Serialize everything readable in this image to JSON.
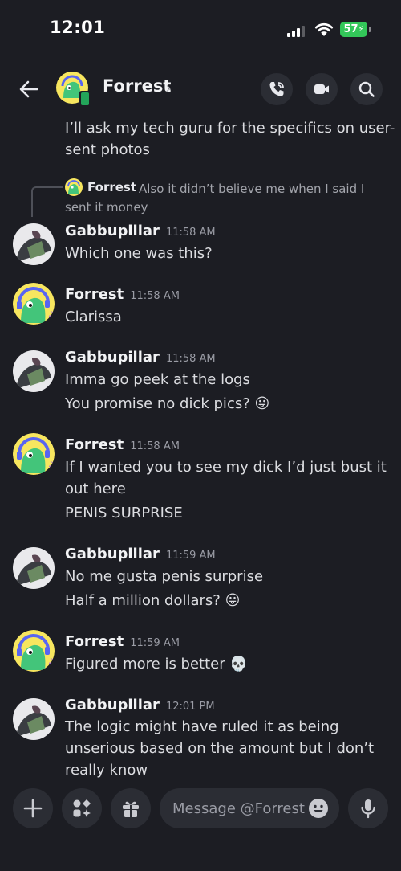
{
  "status_bar": {
    "time": "12:01",
    "battery": "57"
  },
  "header": {
    "title": "Forrest",
    "chevron": "›"
  },
  "messages": {
    "m0": {
      "line1": "I’ll ask my tech guru for the specifics on user-",
      "line2": "sent photos"
    },
    "reply": {
      "name": "Forrest",
      "text": "Also it didn’t believe me when I said I sent it money"
    },
    "m1": {
      "author": "Gabbupillar",
      "time": "11:58 AM",
      "l1": "Which one was this?"
    },
    "m2": {
      "author": "Forrest",
      "time": "11:58 AM",
      "l1": "Clarissa"
    },
    "m3": {
      "author": "Gabbupillar",
      "time": "11:58 AM",
      "l1": "Imma go peek at the logs",
      "l2": "You promise no dick pics? 😛"
    },
    "m4": {
      "author": "Forrest",
      "time": "11:58 AM",
      "l1": "If I wanted you to see my dick I’d just bust it",
      "l2": "out here",
      "l3": "PENIS SURPRISE"
    },
    "m5": {
      "author": "Gabbupillar",
      "time": "11:59 AM",
      "l1": "No me gusta penis surprise",
      "l2": "Half a million dollars? 😛"
    },
    "m6": {
      "author": "Forrest",
      "time": "11:59 AM",
      "l1": "Figured more is better 💀"
    },
    "m7": {
      "author": "Gabbupillar",
      "time": "12:01 PM",
      "l1": "The logic might have ruled it as being",
      "l2": "unserious based on the amount but I don’t",
      "l3": "really know"
    }
  },
  "composer": {
    "placeholder": "Message @Forrest"
  },
  "icons": [
    "back-arrow-icon",
    "phone-call-icon",
    "video-call-icon",
    "search-icon",
    "plus-icon",
    "apps-icon",
    "gift-icon",
    "emoji-icon",
    "microphone-icon"
  ],
  "colors": {
    "background": "#1c1d23",
    "button": "#2b2d34",
    "battery": "#33c759",
    "forrest_avatar": "#f7e65f"
  }
}
